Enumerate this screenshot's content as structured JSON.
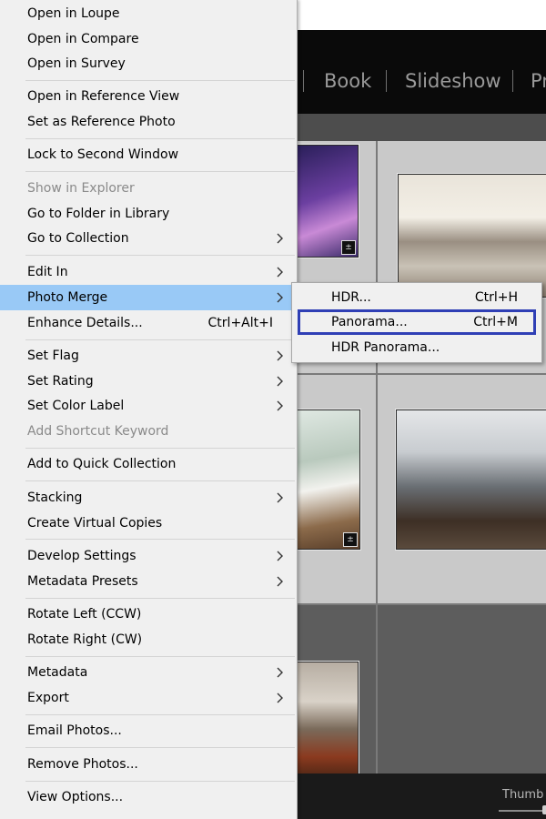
{
  "app": {
    "modules": [
      "Book",
      "Slideshow",
      "Pr"
    ],
    "thumbnail_label": "Thumb"
  },
  "context_menu": {
    "items": [
      {
        "label": "Open in Loupe"
      },
      {
        "label": "Open in Compare"
      },
      {
        "label": "Open in Survey"
      },
      {
        "label": "Open in Reference View"
      },
      {
        "label": "Set as Reference Photo"
      },
      {
        "label": "Lock to Second Window"
      },
      {
        "label": "Show in Explorer",
        "disabled": true
      },
      {
        "label": "Go to Folder in Library"
      },
      {
        "label": "Go to Collection",
        "submenu": true
      },
      {
        "label": "Edit In",
        "submenu": true
      },
      {
        "label": "Photo Merge",
        "submenu": true,
        "active": true
      },
      {
        "label": "Enhance Details...",
        "shortcut": "Ctrl+Alt+I"
      },
      {
        "label": "Set Flag",
        "submenu": true
      },
      {
        "label": "Set Rating",
        "submenu": true
      },
      {
        "label": "Set Color Label",
        "submenu": true
      },
      {
        "label": "Add Shortcut Keyword",
        "disabled": true
      },
      {
        "label": "Add to Quick Collection"
      },
      {
        "label": "Stacking",
        "submenu": true
      },
      {
        "label": "Create Virtual Copies"
      },
      {
        "label": "Develop Settings",
        "submenu": true
      },
      {
        "label": "Metadata Presets",
        "submenu": true
      },
      {
        "label": "Rotate Left (CCW)"
      },
      {
        "label": "Rotate Right (CW)"
      },
      {
        "label": "Metadata",
        "submenu": true
      },
      {
        "label": "Export",
        "submenu": true
      },
      {
        "label": "Email Photos..."
      },
      {
        "label": "Remove Photos..."
      },
      {
        "label": "View Options..."
      }
    ]
  },
  "photo_merge_submenu": {
    "items": [
      {
        "label": "HDR...",
        "shortcut": "Ctrl+H"
      },
      {
        "label": "Panorama...",
        "shortcut": "Ctrl+M",
        "highlighted": true
      },
      {
        "label": "HDR Panorama..."
      }
    ]
  },
  "colors": {
    "menu_bg": "#f0f0f0",
    "active_item": "#99c9f6",
    "highlight_box": "#2f3fb5",
    "disabled_text": "#8a8a8a"
  }
}
